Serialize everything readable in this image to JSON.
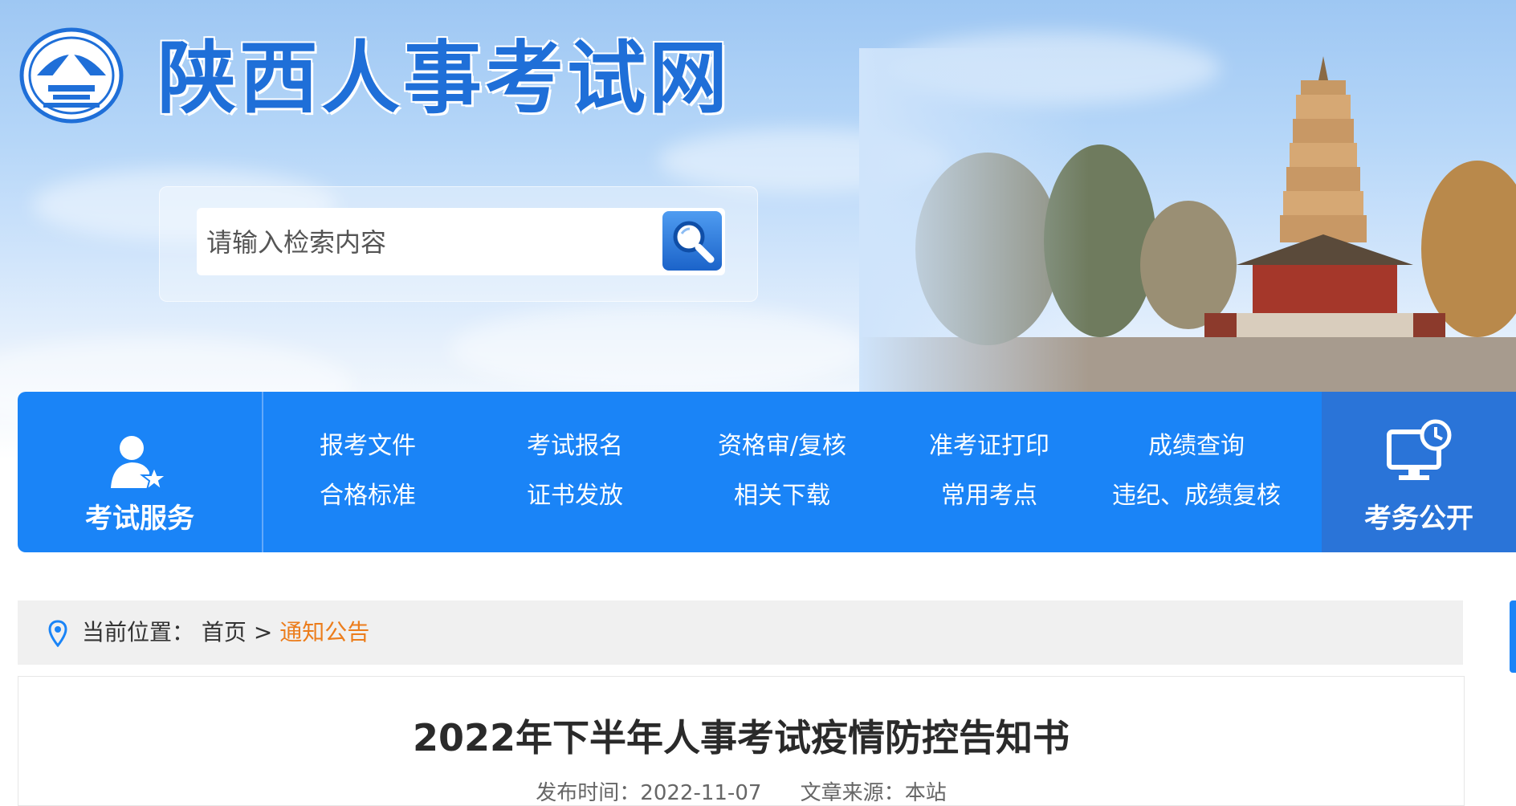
{
  "site": {
    "title": "陕西人事考试网"
  },
  "search": {
    "placeholder": "请输入检索内容",
    "button_icon": "search-icon"
  },
  "nav": {
    "left": {
      "label": "考试服务",
      "icon": "user-star-icon"
    },
    "links": [
      "报考文件",
      "考试报名",
      "资格审/复核",
      "准考证打印",
      "成绩查询",
      "合格标准",
      "证书发放",
      "相关下载",
      "常用考点",
      "违纪、成绩复核"
    ],
    "right": {
      "label": "考务公开",
      "icon": "monitor-clock-icon"
    }
  },
  "breadcrumb": {
    "prefix": "当前位置：",
    "home": "首页",
    "separator": ">",
    "current": "通知公告",
    "icon": "location-pin-icon"
  },
  "article": {
    "title": "2022年下半年人事考试疫情防控告知书",
    "published_label": "发布时间：",
    "published_value": "2022-11-07",
    "source_label": "文章来源：",
    "source_value": "本站"
  },
  "colors": {
    "brand_blue": "#1a84f7",
    "title_blue": "#1f6fd8",
    "accent_orange": "#ec7d1c"
  }
}
